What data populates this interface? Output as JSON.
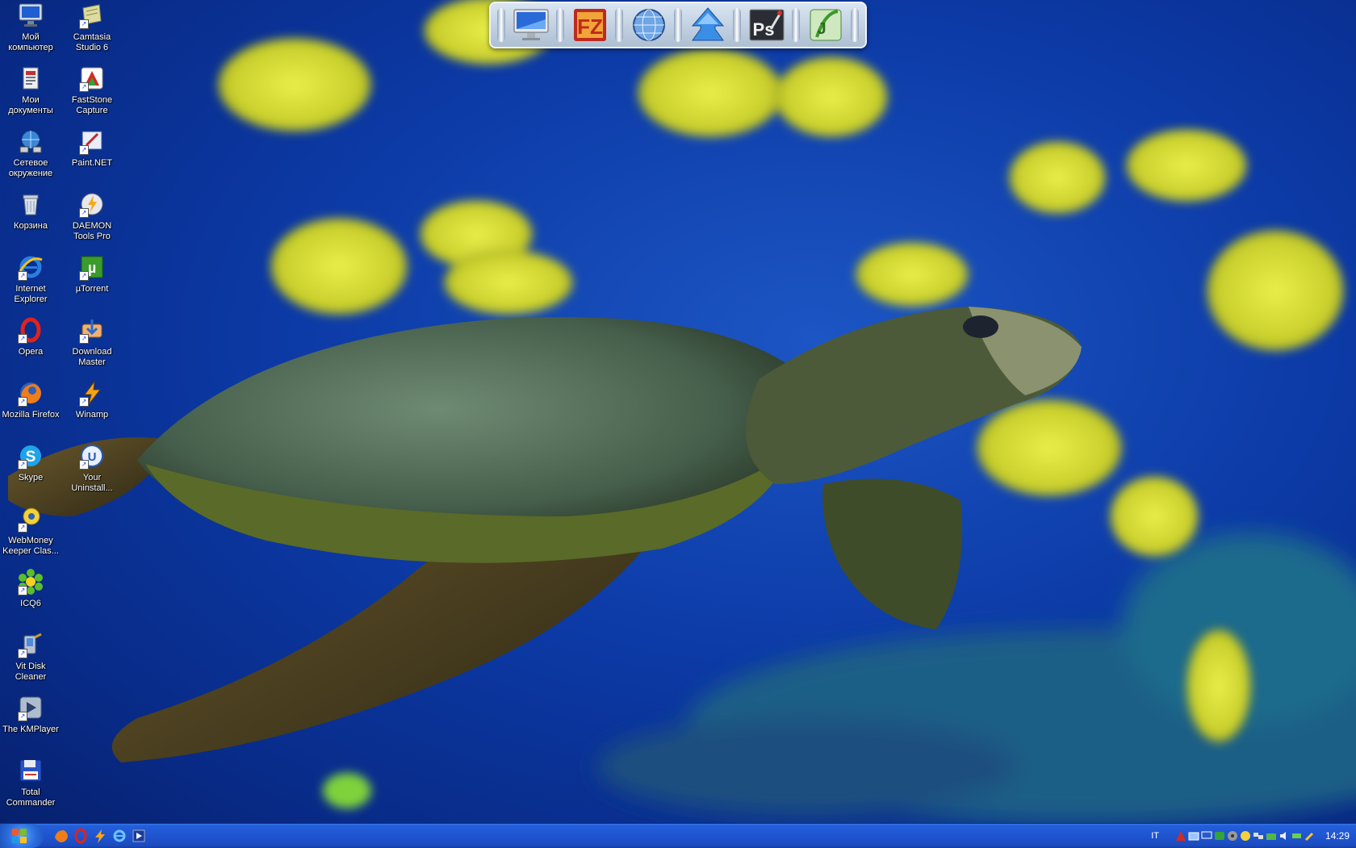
{
  "desktop": {
    "col1": [
      {
        "label": "Мой компьютер",
        "icon": "monitor-icon"
      },
      {
        "label": "Мои документы",
        "icon": "documents-icon"
      },
      {
        "label": "Сетевое окружение",
        "icon": "network-icon"
      },
      {
        "label": "Корзина",
        "icon": "recycle-bin-icon"
      },
      {
        "label": "Internet Explorer",
        "icon": "ie-icon"
      },
      {
        "label": "Opera",
        "icon": "opera-icon"
      },
      {
        "label": "Mozilla Firefox",
        "icon": "firefox-icon"
      },
      {
        "label": "Skype",
        "icon": "skype-icon"
      },
      {
        "label": "WebMoney Keeper Clas...",
        "icon": "webmoney-icon"
      },
      {
        "label": "ICQ6",
        "icon": "icq-icon"
      },
      {
        "label": "Vit Disk Cleaner",
        "icon": "disk-cleaner-icon"
      },
      {
        "label": "The KMPlayer",
        "icon": "kmplayer-icon"
      },
      {
        "label": "Total Commander",
        "icon": "floppy-icon"
      }
    ],
    "col2": [
      {
        "label": "Camtasia Studio 6",
        "icon": "camtasia-icon"
      },
      {
        "label": "FastStone Capture",
        "icon": "faststone-icon"
      },
      {
        "label": "Paint.NET",
        "icon": "paintnet-icon"
      },
      {
        "label": "DAEMON Tools Pro",
        "icon": "daemon-tools-icon"
      },
      {
        "label": "µTorrent",
        "icon": "utorrent-icon"
      },
      {
        "label": "Download Master",
        "icon": "download-master-icon"
      },
      {
        "label": "Winamp",
        "icon": "winamp-icon"
      },
      {
        "label": "Your Uninstall...",
        "icon": "uninstaller-icon"
      }
    ]
  },
  "dock": {
    "apps": [
      "imac-icon",
      "filezilla-icon",
      "globe-icon",
      "upload-arrow-icon",
      "photoshop-icon",
      "dreamweaver-icon"
    ]
  },
  "taskbar": {
    "quick_launch": [
      "firefox-icon",
      "opera-icon",
      "winamp-icon",
      "ie-icon",
      "media-icon"
    ],
    "language": "IT",
    "clock": "14:29"
  }
}
